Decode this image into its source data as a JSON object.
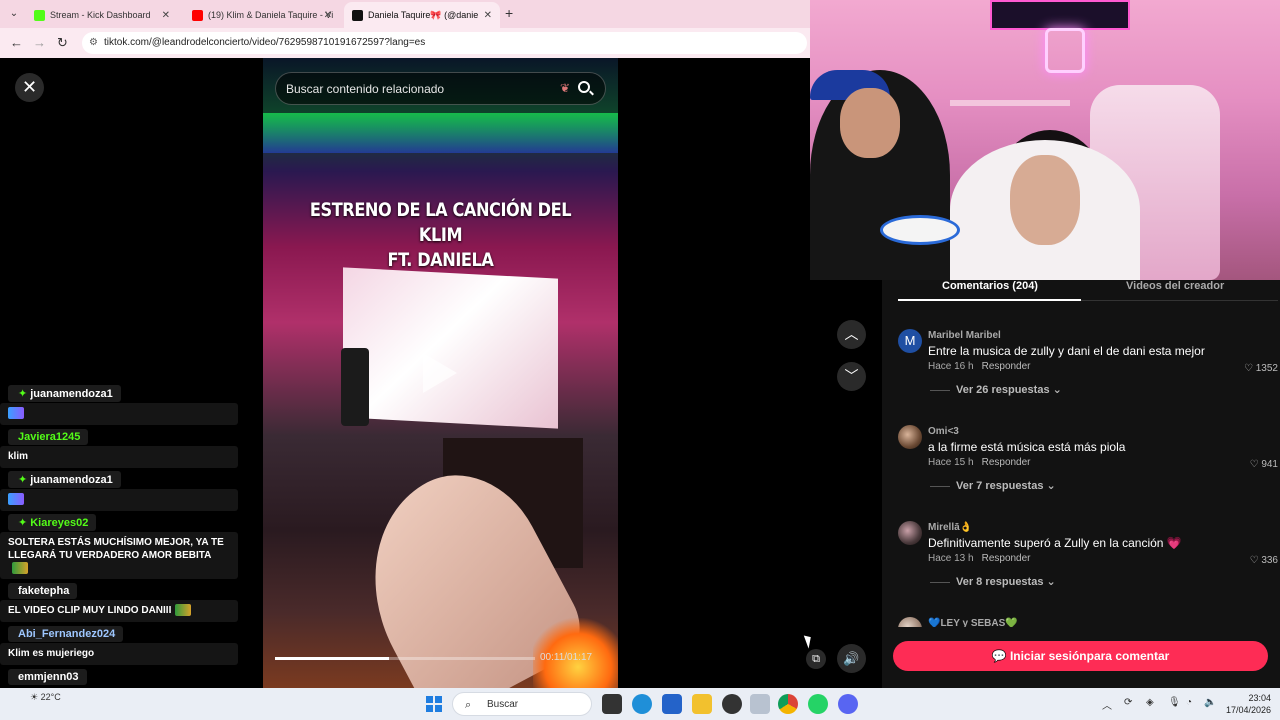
{
  "browser": {
    "tabs": [
      {
        "title": "Stream - Kick Dashboard",
        "color": "#53fc18"
      },
      {
        "title": "(19) Klim & Daniela Taquire - Vi",
        "color": "#ff0000"
      },
      {
        "title": "Daniela Taquire🎀 (@danie",
        "color": "#111111"
      }
    ],
    "url": "tiktok.com/@leandrodelconcierto/video/7629598710191672597?lang=es"
  },
  "video": {
    "search_placeholder": "Buscar contenido relacionado",
    "caption_line1": "ESTRENO DE LA CANCIÓN DEL KLIM",
    "caption_line2": "FT. DANIELA",
    "time": "00:11/01:17",
    "progress": 0.44
  },
  "chat": {
    "messages": [
      {
        "user": "juanamendoza1",
        "text": "",
        "color": "#ffffff",
        "badge": "✦",
        "emote": true
      },
      {
        "user": "Javiera1245",
        "text": "klim",
        "color": "#53fc18",
        "badge": "",
        "emote": false
      },
      {
        "user": "juanamendoza1",
        "text": "",
        "color": "#ffffff",
        "badge": "✦",
        "emote": true
      },
      {
        "user": "Kiareyes02",
        "text": "SOLTERA ESTÁS MUCHÍSIMO MEJOR, YA TE LLEGARÁ TU VERDADERO AMOR BEBITA",
        "color": "#53fc18",
        "badge": "✦",
        "emote": true
      },
      {
        "user": "faketepha",
        "text": "EL VIDEO CLIP MUY LINDO DANIII",
        "color": "#ffffff",
        "badge": "",
        "emote": true
      },
      {
        "user": "Abi_Fernandez024",
        "text": "Klim es mujeriego",
        "color": "#9ec7ff",
        "badge": "",
        "emote": false
      },
      {
        "user": "emmjenn03",
        "text": "",
        "color": "#ffffff",
        "badge": "",
        "emote": false
      }
    ]
  },
  "comments_panel": {
    "tab_comments": "Comentarios (204)",
    "tab_creator": "Videos del creador",
    "comments": [
      {
        "avatar": "M",
        "name": "Maribel Maribel",
        "text": "Entre la musica de zully y dani el de dani esta mejor",
        "time": "Hace 16 h",
        "reply": "Responder",
        "likes": "1352",
        "replies": "Ver 26 respuestas"
      },
      {
        "avatar": "",
        "name": "Omi<3",
        "text": "a la firme está música está más piola",
        "time": "Hace 15 h",
        "reply": "Responder",
        "likes": "941",
        "replies": "Ver 7 respuestas"
      },
      {
        "avatar": "",
        "name": "Mirellā👌",
        "text": "Definitivamente superó a Zully en la canción 💗",
        "time": "Hace 13 h",
        "reply": "Responder",
        "likes": "336",
        "replies": "Ver 8 respuestas"
      },
      {
        "avatar": "",
        "name": "💙LEY y SEBAS💚",
        "text": "",
        "time": "",
        "reply": "",
        "likes": "",
        "replies": ""
      }
    ],
    "login_button": "Iniciar sesiónpara comentar"
  },
  "taskbar": {
    "weather": "22°C",
    "search_placeholder": "Buscar",
    "time": "23:04",
    "date": "17/04/2026"
  }
}
